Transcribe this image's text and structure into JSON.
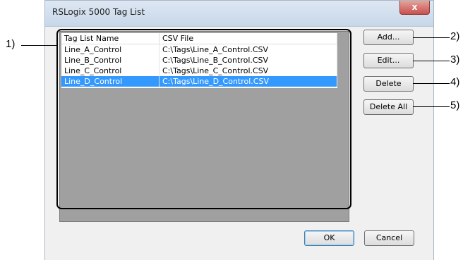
{
  "window": {
    "title": "RSLogix 5000 Tag List",
    "close_glyph": "x"
  },
  "tag_list": {
    "columns": [
      "Tag List Name",
      "CSV File"
    ],
    "rows": [
      {
        "name": "Line_A_Control",
        "csv": "C:\\Tags\\Line_A_Control.CSV",
        "selected": false
      },
      {
        "name": "Line_B_Control",
        "csv": "C:\\Tags\\Line_B_Control.CSV",
        "selected": false
      },
      {
        "name": "Line_C_Control",
        "csv": "C:\\Tags\\Line_C_Control.CSV",
        "selected": false
      },
      {
        "name": "Line_D_Control",
        "csv": "C:\\Tags\\Line_D_Control.CSV",
        "selected": true
      }
    ]
  },
  "buttons": {
    "add": "Add...",
    "edit": "Edit...",
    "delete": "Delete",
    "delete_all": "Delete All",
    "ok": "OK",
    "cancel": "Cancel"
  },
  "callouts": {
    "c1": "1)",
    "c2": "2)",
    "c3": "3)",
    "c4": "4)",
    "c5": "5)"
  }
}
